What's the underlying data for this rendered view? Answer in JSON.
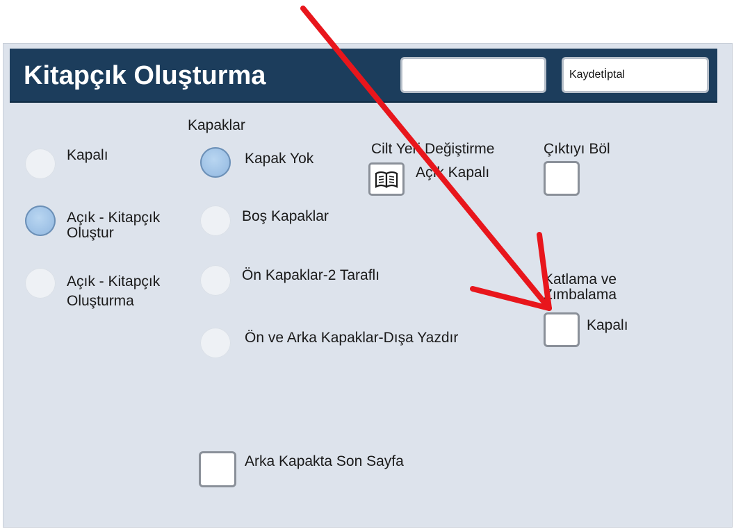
{
  "header": {
    "title": "Kitapçık Oluşturma",
    "buttons_label": "Kaydetİptal"
  },
  "booklet_options": [
    {
      "label": "Kapalı",
      "selected": false
    },
    {
      "label": "Açık - Kitapçık Oluştur",
      "selected": true
    },
    {
      "label": "Açık - Kitapçık Oluşturma",
      "selected": false
    }
  ],
  "covers": {
    "title": "Kapaklar",
    "options": [
      {
        "label": "Kapak Yok",
        "selected": true
      },
      {
        "label": "Boş Kapaklar",
        "selected": false
      },
      {
        "label": "Ön Kapaklar-2 Taraflı",
        "selected": false
      },
      {
        "label": "Ön ve Arka Kapaklar-Dışa Yazdır",
        "selected": false
      }
    ]
  },
  "binding_shift": {
    "title": "Cilt Yeri Değiştirme",
    "value": "Açık Kapalı",
    "icon": "open-book-icon"
  },
  "split_output": {
    "title": "Çıktıyı Böl",
    "checked": false
  },
  "fold_staple": {
    "title": "Katlama ve Zımbalama",
    "value": "Kapalı",
    "checked": false
  },
  "last_page_back_cover": {
    "label": "Arka Kapakta Son Sayfa",
    "checked": false
  },
  "colors": {
    "header_bg": "#1c3d5c",
    "panel_bg": "#dde3ec",
    "radio_selected": "#9fc2e6",
    "annotation_arrow": "#e8161c"
  }
}
